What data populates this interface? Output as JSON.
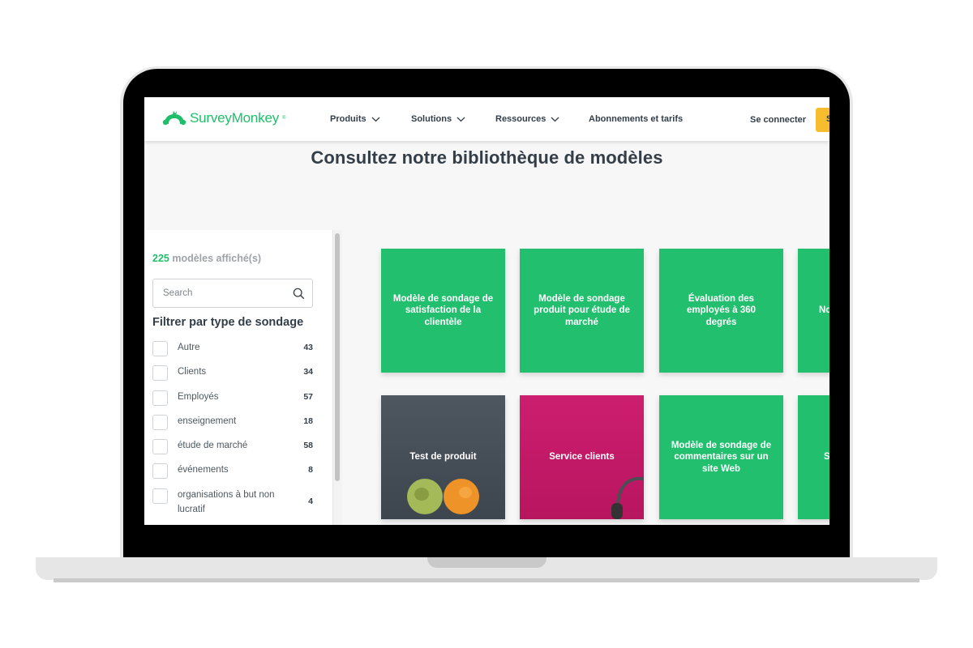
{
  "header": {
    "brand": "SurveyMonkey",
    "brand_mark": "®",
    "nav": [
      {
        "label": "Produits",
        "has_dropdown": true
      },
      {
        "label": "Solutions",
        "has_dropdown": true
      },
      {
        "label": "Ressources",
        "has_dropdown": true
      },
      {
        "label": "Abonnements et tarifs",
        "has_dropdown": false
      }
    ],
    "login_label": "Se connecter",
    "signup_label": "S"
  },
  "hero": {
    "title": "Consultez notre bibliothèque de modèles"
  },
  "sidebar": {
    "result_count": "225",
    "result_suffix": " modèles affiché(s)",
    "search": {
      "placeholder": "Search",
      "value": ""
    },
    "filter_heading": "Filtrer par type de sondage",
    "filters": [
      {
        "label": "Autre",
        "count": "43",
        "checked": false
      },
      {
        "label": "Clients",
        "count": "34",
        "checked": false
      },
      {
        "label": "Employés",
        "count": "57",
        "checked": false
      },
      {
        "label": "enseignement",
        "count": "18",
        "checked": false
      },
      {
        "label": "étude de marché",
        "count": "58",
        "checked": false
      },
      {
        "label": "événements",
        "count": "8",
        "checked": false
      },
      {
        "label": "organisations à but non lucratif",
        "count": "4",
        "checked": false
      }
    ]
  },
  "templates": [
    {
      "title": "Modèle de sondage de satisfaction de la clientèle",
      "style": "green"
    },
    {
      "title": "Modèle de sondage produit pour étude de marché",
      "style": "green"
    },
    {
      "title": "Évaluation des employés à 360 degrés",
      "style": "green"
    },
    {
      "title": "No",
      "style": "green"
    },
    {
      "title": "Test de produit",
      "style": "dark",
      "image": "apple-orange"
    },
    {
      "title": "Service clients",
      "style": "pink",
      "image": "headset"
    },
    {
      "title": "Modèle de sondage de commentaires sur un site Web",
      "style": "green"
    },
    {
      "title": "S",
      "style": "green"
    }
  ],
  "colors": {
    "brand_green": "#1fbf6a",
    "card_green": "#22c06e",
    "card_dark": "#474f59",
    "card_pink": "#c41a68",
    "signup_yellow": "#f7bd2f",
    "text_dark": "#333e48"
  }
}
